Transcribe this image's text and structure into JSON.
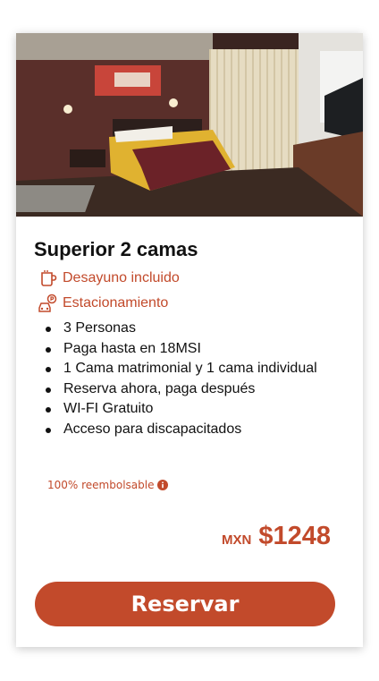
{
  "room": {
    "image_alt": "Habitación Superior 2 camas",
    "title": "Superior 2 camas",
    "amenities": [
      {
        "label": "Desayuno incluido",
        "icon": "coffee-cup-icon"
      },
      {
        "label": "Estacionamiento",
        "icon": "parking-car-icon"
      }
    ],
    "features": [
      "3 Personas",
      "Paga hasta en 18MSI",
      "1 Cama matrimonial y 1 cama individual",
      "Reserva ahora, paga después",
      "WI-FI Gratuito",
      "Acceso para discapacitados"
    ],
    "refund_text": "100% reembolsable",
    "currency": "MXN",
    "price": "$1248",
    "reserve_label": "Reservar"
  },
  "colors": {
    "accent": "#c24a2b",
    "text": "#111111",
    "background": "#ffffff"
  }
}
